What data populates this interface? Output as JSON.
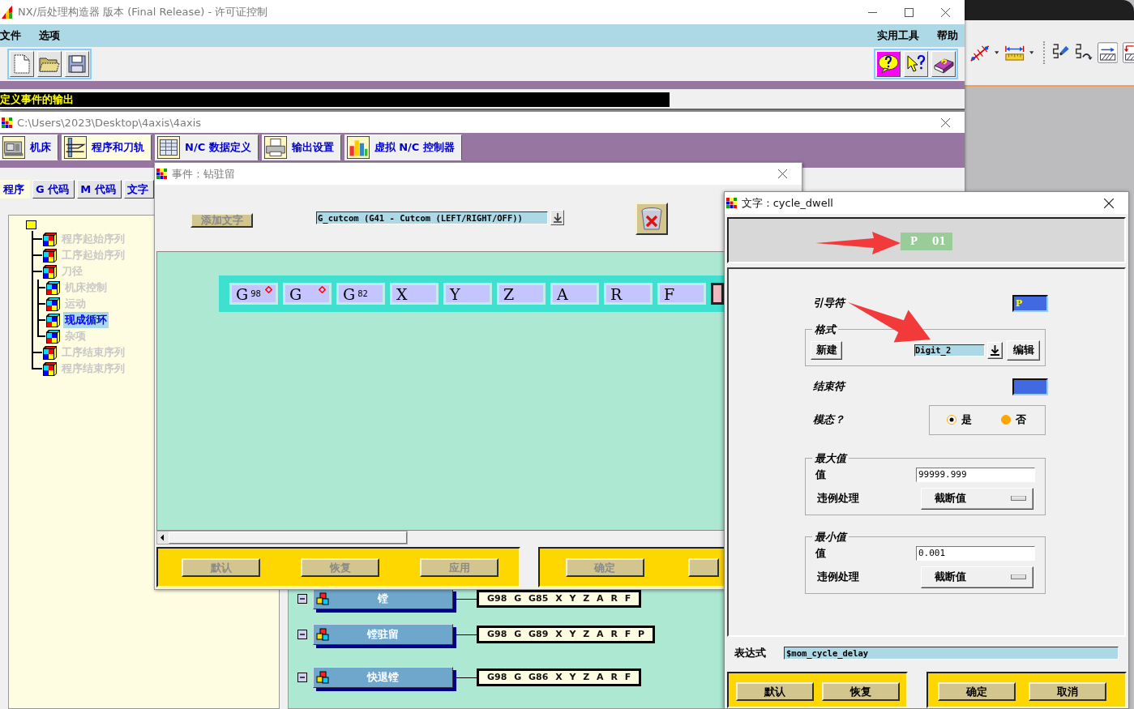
{
  "main_window": {
    "title": "NX/后处理构造器 版本 (Final Release) - 许可证控制",
    "menu_left": [
      "文件",
      "选项"
    ],
    "menu_right": [
      "实用工具",
      "帮助"
    ],
    "file_tools": [
      {
        "kind": "new"
      },
      {
        "kind": "open"
      },
      {
        "kind": "save"
      }
    ],
    "help_tools": [
      {
        "kind": "balloon",
        "on": true
      },
      {
        "kind": "context",
        "on": false
      },
      {
        "kind": "manual",
        "on": false
      }
    ],
    "status": "定义事件的输出"
  },
  "project_window": {
    "title": "C:\\Users\\2023\\Desktop\\4axis\\4axis",
    "tabs": [
      {
        "label": "机床",
        "kind": "machine",
        "selected": false
      },
      {
        "label": "程序和刀轨",
        "kind": "program",
        "selected": true
      },
      {
        "label": "N/C 数据定义",
        "kind": "data",
        "selected": false
      },
      {
        "label": "输出设置",
        "kind": "output",
        "selected": false
      },
      {
        "label": "虚拟 N/C 控制器",
        "kind": "controller",
        "selected": false
      }
    ],
    "subtabs": [
      {
        "label": "程序",
        "selected": true
      },
      {
        "label": "G 代码",
        "selected": false
      },
      {
        "label": "M 代码",
        "selected": false
      },
      {
        "label": "文字",
        "selected": false
      }
    ],
    "tree": {
      "children": [
        {
          "label": "程序起始序列",
          "selected": false
        },
        {
          "label": "工序起始序列",
          "selected": false
        },
        {
          "label": "刀径",
          "selected": false,
          "children": [
            {
              "label": "机床控制",
              "selected": false
            },
            {
              "label": "运动",
              "selected": false
            },
            {
              "label": "现成循环",
              "selected": true
            },
            {
              "label": "杂项",
              "selected": false
            }
          ]
        },
        {
          "label": "工序结束序列",
          "selected": false
        },
        {
          "label": "程序结束序列",
          "selected": false
        }
      ]
    },
    "events": [
      {
        "label": "镗",
        "block": "G98 G G85 X Y Z A R F"
      },
      {
        "label": "镗驻留",
        "block": "G98 G G89 X Y Z A R F P"
      },
      {
        "label": "快退镗",
        "block": "G98 G G86 X Y Z A R F"
      }
    ]
  },
  "event_dialog": {
    "title": "事件 : 钻驻留",
    "add_word_button": "添加文字",
    "word_select": "G_cutcom (G41 - Cutcom (LEFT/RIGHT/OFF))",
    "blocks": [
      {
        "word": "G",
        "sub": "98",
        "marked": true,
        "selected": false
      },
      {
        "word": "G",
        "marked": true,
        "selected": false
      },
      {
        "word": "G",
        "sub": "82",
        "marked": false,
        "selected": false
      },
      {
        "word": "X",
        "marked": false,
        "selected": false
      },
      {
        "word": "Y",
        "marked": false,
        "selected": false
      },
      {
        "word": "Z",
        "marked": false,
        "selected": false
      },
      {
        "word": "A",
        "marked": false,
        "selected": false
      },
      {
        "word": "R",
        "marked": false,
        "selected": false
      },
      {
        "word": "F",
        "marked": false,
        "selected": false
      },
      {
        "marked": false,
        "selected": true
      }
    ],
    "buttons_left": [
      {
        "label": "默认",
        "disabled": true
      },
      {
        "label": "恢复",
        "disabled": true
      },
      {
        "label": "应用",
        "disabled": true
      }
    ],
    "buttons_right": [
      {
        "label": "确定",
        "disabled": true
      },
      {
        "kind": "clipped"
      }
    ]
  },
  "word_dialog": {
    "title": "文字 : cycle_dwell",
    "preview": [
      "P",
      "01"
    ],
    "leader_label": "引导符",
    "leader": "P",
    "format_label": "格式",
    "format_new": "新建",
    "format": "Digit_2",
    "format_edit": "编辑",
    "trailer_label": "结束符",
    "modal_label": "模态？",
    "modal_options": [
      {
        "label": "是",
        "selected": true
      },
      {
        "label": "否",
        "selected": false
      }
    ],
    "limits": [
      {
        "title": "最大值",
        "value_label": "值",
        "value": "99999.999",
        "violation_label": "违例处理",
        "violation": "截断值"
      },
      {
        "title": "最小值",
        "value_label": "值",
        "value": "0.001",
        "violation_label": "违例处理",
        "violation": "截断值"
      }
    ],
    "expression_label": "表达式",
    "expression": "$mom_cycle_delay",
    "buttons_left": [
      {
        "label": "默认",
        "disabled": false
      },
      {
        "label": "恢复",
        "disabled": false
      }
    ],
    "buttons_right": [
      {
        "label": "确定",
        "disabled": false
      },
      {
        "label": "取消",
        "disabled": false
      }
    ]
  }
}
